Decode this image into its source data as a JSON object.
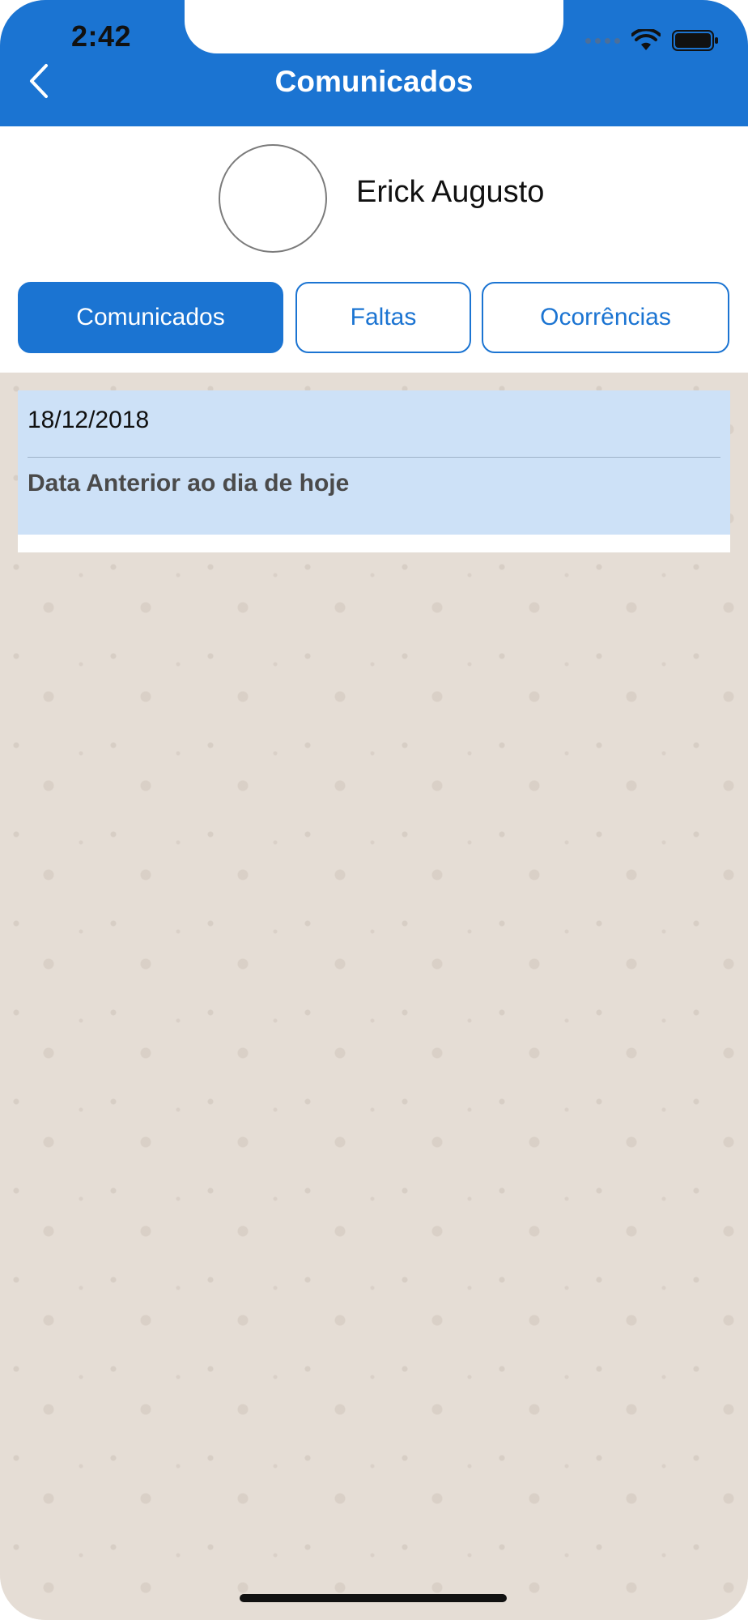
{
  "status_bar": {
    "time": "2:42",
    "signal_icon": "cellular-signal-icon",
    "wifi_icon": "wifi-icon",
    "battery_icon": "battery-icon"
  },
  "header": {
    "title": "Comunicados",
    "back_icon": "chevron-left-icon",
    "background_color": "#1b74d2"
  },
  "profile": {
    "name": "Erick Augusto",
    "avatar_icon": "avatar-placeholder"
  },
  "tabs": [
    {
      "label": "Comunicados",
      "active": true
    },
    {
      "label": "Faltas",
      "active": false
    },
    {
      "label": "Ocorrências",
      "active": false
    }
  ],
  "messages": [
    {
      "date": "18/12/2018",
      "text": "Data Anterior ao dia de hoje"
    }
  ],
  "colors": {
    "accent": "#1b74d2",
    "card_background": "#cde1f7",
    "chat_background": "#e5ddd5"
  }
}
